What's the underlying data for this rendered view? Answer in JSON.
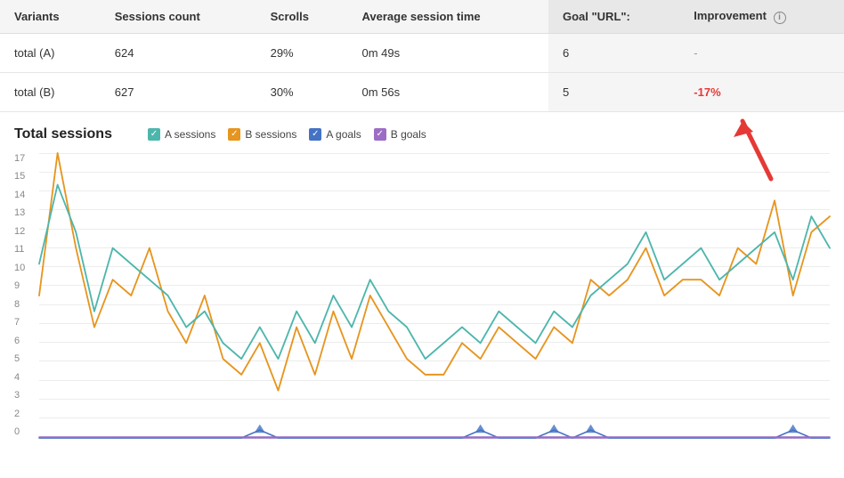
{
  "table": {
    "headers": [
      "Variants",
      "Sessions count",
      "Scrolls",
      "Average session time",
      "Goal \"URL\":",
      "Improvement"
    ],
    "rows": [
      {
        "variant": "total (A)",
        "sessions": "624",
        "scrolls": "29%",
        "avg_session": "0m 49s",
        "goal": "6",
        "improvement": "-",
        "improvement_type": "dash"
      },
      {
        "variant": "total (B)",
        "sessions": "627",
        "scrolls": "30%",
        "avg_session": "0m 56s",
        "goal": "5",
        "improvement": "-17%",
        "improvement_type": "negative"
      }
    ]
  },
  "chart": {
    "title": "Total sessions",
    "legend": [
      {
        "label": "A sessions",
        "color": "#4db6ac",
        "type": "check"
      },
      {
        "label": "B sessions",
        "color": "#e6951e",
        "type": "check"
      },
      {
        "label": "A goals",
        "color": "#4472c4",
        "type": "check"
      },
      {
        "label": "B goals",
        "color": "#9c6dc5",
        "type": "check"
      }
    ],
    "y_labels": [
      "0",
      "2",
      "3",
      "4",
      "5",
      "6",
      "7",
      "8",
      "9",
      "10",
      "11",
      "12",
      "13",
      "14",
      "15",
      "17"
    ],
    "a_sessions": [
      11,
      16,
      13,
      8,
      12,
      11,
      10,
      9,
      7,
      8,
      6,
      5,
      7,
      5,
      8,
      6,
      9,
      7,
      10,
      8,
      7,
      5,
      6,
      7,
      6,
      8,
      7,
      6,
      8,
      7,
      9,
      10,
      11,
      13,
      10,
      11,
      12,
      10,
      11,
      12,
      13,
      10,
      14,
      12
    ],
    "b_sessions": [
      9,
      18,
      12,
      7,
      10,
      9,
      12,
      8,
      6,
      9,
      5,
      4,
      6,
      3,
      7,
      4,
      8,
      5,
      9,
      7,
      5,
      4,
      4,
      6,
      5,
      7,
      6,
      5,
      7,
      6,
      10,
      9,
      10,
      12,
      9,
      10,
      10,
      9,
      12,
      11,
      15,
      9,
      13,
      14
    ],
    "a_goals": [
      0,
      0,
      0,
      0,
      0,
      0,
      0,
      0,
      0,
      0,
      0,
      0,
      1,
      0,
      0,
      0,
      0,
      0,
      0,
      0,
      0,
      0,
      0,
      0,
      1,
      0,
      0,
      0,
      1,
      0,
      1,
      0,
      0,
      0,
      0,
      0,
      0,
      0,
      0,
      0,
      0,
      1,
      0,
      0
    ],
    "b_goals": [
      0,
      0,
      0,
      0,
      0,
      0,
      0,
      0,
      0,
      0,
      0,
      0,
      0,
      0,
      0,
      0,
      0,
      0,
      0,
      0,
      0,
      0,
      0,
      0,
      0,
      0,
      0,
      0,
      0,
      0,
      0,
      0,
      0,
      0,
      0,
      0,
      0,
      0,
      0,
      0,
      0,
      0,
      0,
      0
    ]
  }
}
